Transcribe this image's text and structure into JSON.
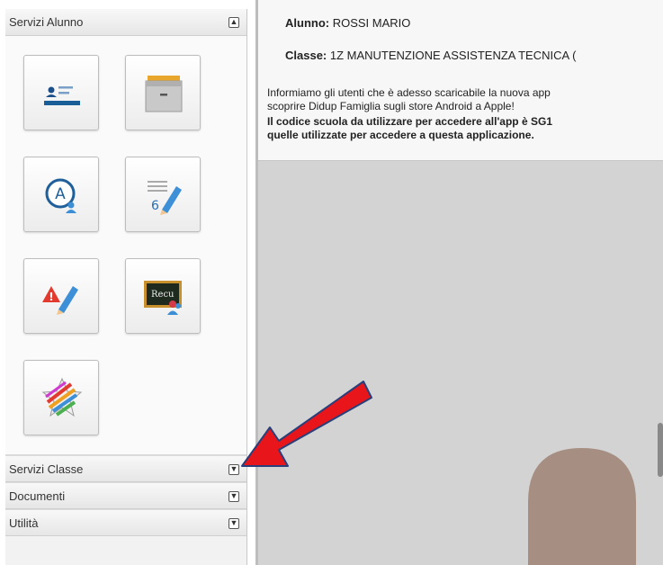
{
  "sidebar": {
    "sections": [
      {
        "label": "Servizi Alunno",
        "toggle": "▲"
      },
      {
        "label": "Servizi Classe",
        "toggle": "▼"
      },
      {
        "label": "Documenti",
        "toggle": "▼"
      },
      {
        "label": "Utilità",
        "toggle": "▼"
      }
    ],
    "icons": [
      "student-card-icon",
      "archive-folder-icon",
      "absence-icon",
      "grades-icon",
      "disciplinary-notes-icon",
      "recovery-icon",
      "star-icon"
    ]
  },
  "main": {
    "student_label": "Alunno:",
    "student_name": "ROSSI MARIO",
    "class_label": "Classe:",
    "class_name": "1Z MANUTENZIONE ASSISTENZA TECNICA (",
    "notice_line1": "Informiamo gli utenti che è adesso scaricabile la nuova app",
    "notice_line2": "scoprire Didup Famiglia sugli store Android a Apple!",
    "notice_bold1": "Il codice scuola da utilizzare per accedere all'app è SG1",
    "notice_bold2": "quelle utilizzate per accedere a questa applicazione."
  },
  "annotation": {
    "color": "#e8161b"
  },
  "colors": {
    "sidebar_bg": "#f2f2f2",
    "main_bg": "#d3d3d3",
    "avatar": "#a68f82"
  }
}
